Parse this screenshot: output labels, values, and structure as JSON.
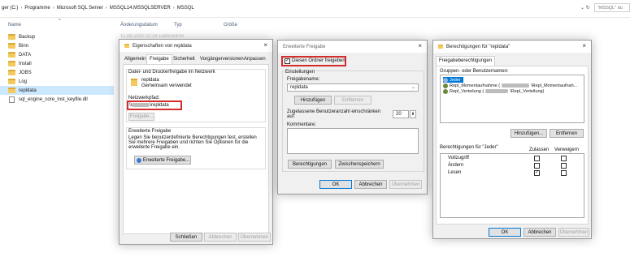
{
  "explorer": {
    "breadcrumbs": [
      "ger (C:)",
      "Programme",
      "Microsoft SQL Server",
      "MSSQL14.MSSQLSERVER",
      "MSSQL"
    ],
    "search_placeholder": "\"MSSQL\" du",
    "columns": {
      "name": "Name",
      "date": "Änderungsdatum",
      "type": "Typ",
      "size": "Größe"
    },
    "date_ghost": "11.09.2020 11:26     Dateiordner",
    "files": [
      {
        "name": "Backup",
        "kind": "folder"
      },
      {
        "name": "Binn",
        "kind": "folder"
      },
      {
        "name": "DATA",
        "kind": "folder"
      },
      {
        "name": "Install",
        "kind": "folder"
      },
      {
        "name": "JOBS",
        "kind": "folder"
      },
      {
        "name": "Log",
        "kind": "folder"
      },
      {
        "name": "repldata",
        "kind": "folder",
        "selected": true
      },
      {
        "name": "sql_engine_core_inst_keyfile.dll",
        "kind": "file"
      }
    ]
  },
  "props": {
    "title": "Eigenschaften von repldata",
    "tabs": [
      "Allgemein",
      "Freigabe",
      "Sicherheit",
      "Vorgängerversionen",
      "Anpassen"
    ],
    "share_group_title": "Datei- und Druckerfreigabe im Netzwerk",
    "share_name": "repldata",
    "share_status": "Gemeinsam verwendet",
    "netpath_label": "Netzwerkpfad:",
    "netpath_prefix": "\\\\",
    "netpath_suffix": "\\repldata",
    "share_button": "Freigabe...",
    "adv_group_title": "Erweiterte Freigabe",
    "adv_text": "Legen Sie benutzerdefinierte Berechtigungen fest, erstellen Sie mehrere Freigaben und richten Sie Optionen für die erweiterte Freigabe ein.",
    "adv_button": "Erweiterte Freigabe...",
    "close_button": "Schließen",
    "cancel_button": "Abbrechen",
    "apply_button": "Übernehmen"
  },
  "advanced": {
    "title": "Erweiterte Freigabe",
    "share_checkbox": "Diesen Ordner freigeben",
    "share_checked": true,
    "settings_title": "Einstellungen",
    "share_name_label": "Freigabename:",
    "share_name_value": "repldata",
    "add_button": "Hinzufügen",
    "remove_button": "Entfernen",
    "limit_label_1": "Zugelassene Benutzeranzahl einschränken",
    "limit_label_2": "auf:",
    "limit_value": "20",
    "comments_label": "Kommentare:",
    "permissions_button": "Berechtigungen",
    "caching_button": "Zwischenspeichern",
    "ok_button": "OK",
    "cancel_button": "Abbrechen",
    "apply_button": "Übernehmen"
  },
  "perms": {
    "title": "Berechtigungen für \"repldata\"",
    "tab": "Freigabeberechtigungen",
    "groups_label": "Gruppen- oder Benutzernamen:",
    "users": [
      {
        "prefix": "Jeder",
        "suffix": "",
        "selected": true
      },
      {
        "prefix": "Repl_Momentaufnahme (",
        "suffix": "\\Repl_Momentaufnah...",
        "selected": false
      },
      {
        "prefix": "Repl_Verteilung (",
        "suffix": "\\Repl_Verteilung)",
        "selected": false
      }
    ],
    "add_button": "Hinzufügen...",
    "remove_button": "Entfernen",
    "perm_for_label": "Berechtigungen für \"Jeder\"",
    "allow_header": "Zulassen",
    "deny_header": "Verweigern",
    "permissions": [
      {
        "name": "Vollzugriff",
        "allow": false,
        "deny": false
      },
      {
        "name": "Ändern",
        "allow": false,
        "deny": false
      },
      {
        "name": "Lesen",
        "allow": true,
        "deny": false
      }
    ],
    "ok_button": "OK",
    "cancel_button": "Abbrechen",
    "apply_button": "Übernehmen"
  },
  "colors": {
    "highlight_red": "#d42b2b",
    "selection": "#cce8ff",
    "user_selected": "#0078d7"
  }
}
